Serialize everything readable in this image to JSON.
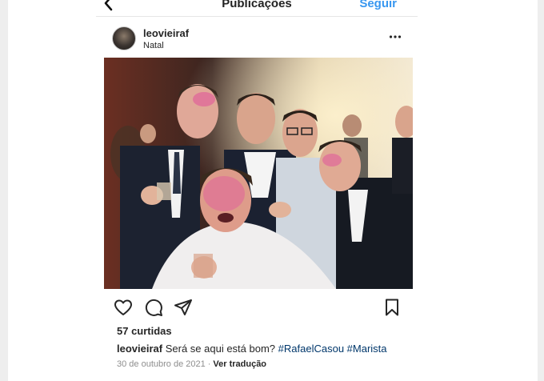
{
  "header": {
    "title": "Publicações",
    "follow_label": "Seguir"
  },
  "post": {
    "username": "leovieiraf",
    "location": "Natal",
    "likes": "57 curtidas",
    "caption": {
      "username": "leovieiraf",
      "text": "Será se aqui está bom?",
      "hashtags": [
        "#RafaelCasou",
        "#Marista"
      ]
    },
    "date": "30 de outubro de 2021",
    "separator": "·",
    "translate_label": "Ver tradução"
  },
  "icons": {
    "back": "chevron-left-icon",
    "more": "more-horizontal-icon",
    "like": "heart-icon",
    "comment": "comment-icon",
    "share": "send-icon",
    "save": "bookmark-icon"
  },
  "colors": {
    "link": "#3897f0",
    "hashtag": "#00376b",
    "muted": "#8e8e8e",
    "text": "#262626"
  }
}
